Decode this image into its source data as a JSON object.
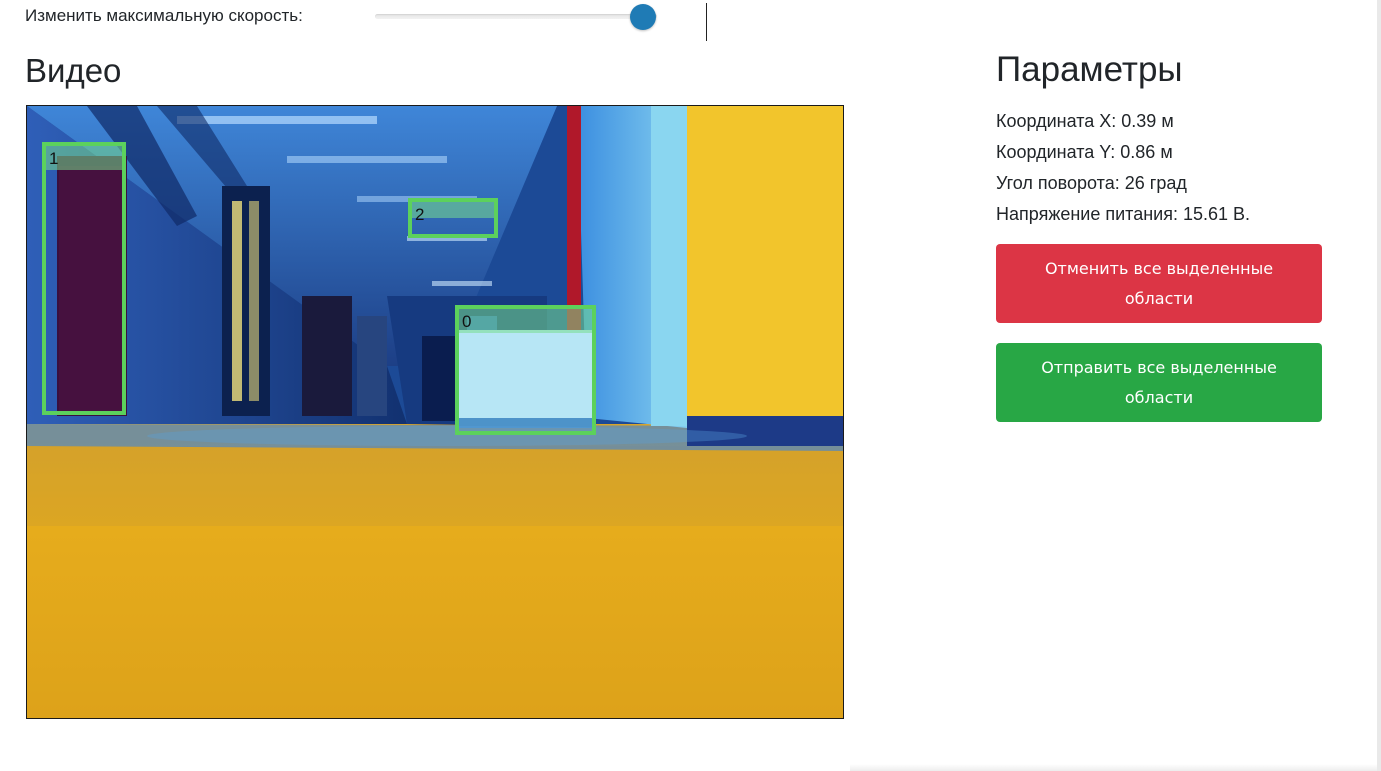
{
  "speed": {
    "label": "Изменить максимальную скорость:",
    "value_fraction": 0.95
  },
  "video": {
    "title": "Видео",
    "regions": [
      {
        "id": "1"
      },
      {
        "id": "2"
      },
      {
        "id": "0"
      }
    ]
  },
  "params": {
    "title": "Параметры",
    "coord_x": "Координата X: 0.39 м",
    "coord_y": "Координата Y: 0.86 м",
    "angle": "Угол поворота: 26 град",
    "voltage": "Напряжение питания: 15.61 В.",
    "cancel_label": "Отменить все выделенные области",
    "send_label": "Отправить все выделенные области"
  },
  "colors": {
    "danger": "#dc3545",
    "success": "#28a745",
    "slider_thumb": "#1f7bb5",
    "bbox": "#5cd15c"
  }
}
